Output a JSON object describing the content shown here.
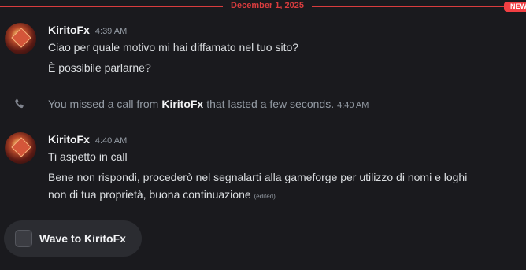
{
  "divider": {
    "date": "December 1, 2025",
    "new_badge": "NEW"
  },
  "messages": [
    {
      "author": "KiritoFx",
      "timestamp": "4:39 AM",
      "lines": [
        "Ciao per quale motivo mi hai diffamato nel tuo sito?",
        "È possibile parlarne?"
      ]
    },
    {
      "author": "KiritoFx",
      "timestamp": "4:40 AM",
      "lines": [
        "Ti aspetto in call",
        "Bene non rispondi, procederò nel segnalarti alla gameforge per utilizzo di nomi e loghi",
        "non di tua proprietà, buona continuazione"
      ],
      "edited_label": "(edited)"
    }
  ],
  "call_notice": {
    "prefix": "You missed a call from",
    "caller": "KiritoFx",
    "suffix": "that lasted a few seconds.",
    "timestamp": "4:40 AM",
    "icon": "phone-missed-icon"
  },
  "wave_button": {
    "label": "Wave to KiritoFx",
    "icon": "wave-sticker-icon"
  },
  "colors": {
    "accent_red": "#f23f43",
    "background": "#1a1a1e",
    "muted": "#949ba4"
  }
}
